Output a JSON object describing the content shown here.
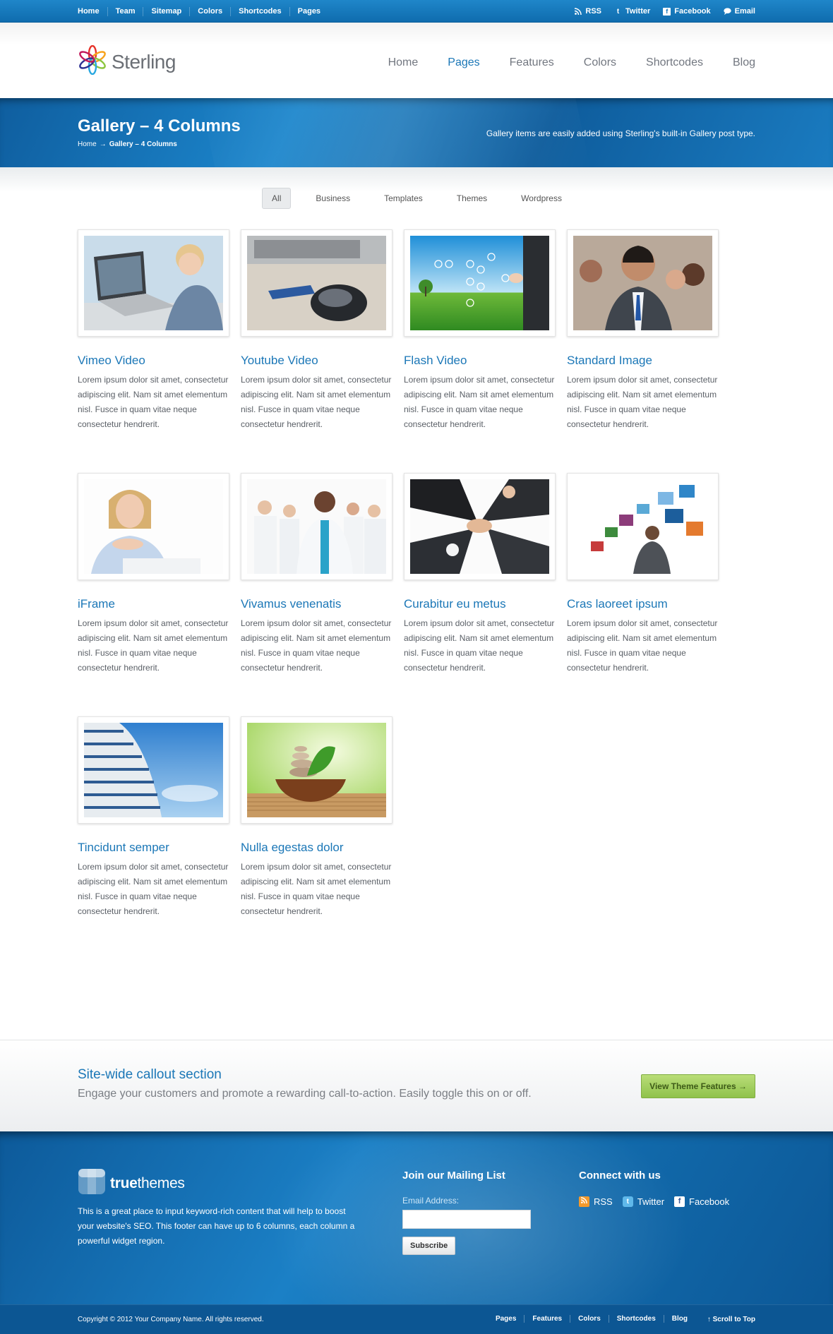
{
  "top_bar": {
    "nav": [
      "Home",
      "Team",
      "Sitemap",
      "Colors",
      "Shortcodes",
      "Pages"
    ],
    "social": [
      {
        "label": "RSS",
        "icon": "rss-icon"
      },
      {
        "label": "Twitter",
        "icon": "twitter-icon"
      },
      {
        "label": "Facebook",
        "icon": "facebook-icon"
      },
      {
        "label": "Email",
        "icon": "email-icon"
      }
    ]
  },
  "header": {
    "logo_text": "Sterling",
    "nav": [
      "Home",
      "Pages",
      "Features",
      "Colors",
      "Shortcodes",
      "Blog"
    ],
    "active": "Pages"
  },
  "banner": {
    "title": "Gallery – 4 Columns",
    "breadcrumb_home": "Home",
    "breadcrumb_arrow": "→",
    "breadcrumb_current": "Gallery – 4 Columns",
    "tagline": "Gallery items are easily added using Sterling's built-in Gallery post type."
  },
  "filters": [
    "All",
    "Business",
    "Templates",
    "Themes",
    "Wordpress"
  ],
  "active_filter": "All",
  "gallery": [
    {
      "title": "Vimeo Video",
      "text": "Lorem ipsum dolor sit amet, consectetur adipiscing elit. Nam sit amet elementum nisl. Fusce in quam vitae neque consectetur hendrerit."
    },
    {
      "title": "Youtube Video",
      "text": "Lorem ipsum dolor sit amet, consectetur adipiscing elit. Nam sit amet elementum nisl. Fusce in quam vitae neque consectetur hendrerit."
    },
    {
      "title": "Flash Video",
      "text": "Lorem ipsum dolor sit amet, consectetur adipiscing elit. Nam sit amet elementum nisl. Fusce in quam vitae neque consectetur hendrerit."
    },
    {
      "title": "Standard Image",
      "text": "Lorem ipsum dolor sit amet, consectetur adipiscing elit. Nam sit amet elementum nisl. Fusce in quam vitae neque consectetur hendrerit."
    },
    {
      "title": "iFrame",
      "text": "Lorem ipsum dolor sit amet, consectetur adipiscing elit. Nam sit amet elementum nisl. Fusce in quam vitae neque consectetur hendrerit."
    },
    {
      "title": "Vivamus venenatis",
      "text": "Lorem ipsum dolor sit amet, consectetur adipiscing elit. Nam sit amet elementum nisl. Fusce in quam vitae neque consectetur hendrerit."
    },
    {
      "title": "Curabitur eu metus",
      "text": "Lorem ipsum dolor sit amet, consectetur adipiscing elit. Nam sit amet elementum nisl. Fusce in quam vitae neque consectetur hendrerit."
    },
    {
      "title": "Cras laoreet ipsum",
      "text": "Lorem ipsum dolor sit amet, consectetur adipiscing elit. Nam sit amet elementum nisl. Fusce in quam vitae neque consectetur hendrerit."
    },
    {
      "title": "Tincidunt semper",
      "text": "Lorem ipsum dolor sit amet, consectetur adipiscing elit. Nam sit amet elementum nisl. Fusce in quam vitae neque consectetur hendrerit."
    },
    {
      "title": "Nulla egestas dolor",
      "text": "Lorem ipsum dolor sit amet, consectetur adipiscing elit. Nam sit amet elementum nisl. Fusce in quam vitae neque consectetur hendrerit."
    }
  ],
  "callout": {
    "title": "Site-wide callout section",
    "text": "Engage your customers and promote a rewarding call-to-action. Easily toggle this on or off.",
    "button": "View Theme Features →"
  },
  "footer": {
    "logo_bold": "true",
    "logo_light": "themes",
    "about": "This is a great place to input keyword-rich content that will help to boost your website's SEO. This footer can have up to 6 columns, each column a powerful widget region.",
    "mailing_title": "Join our Mailing List",
    "email_label": "Email Address:",
    "subscribe": "Subscribe",
    "connect_title": "Connect with us",
    "connect": [
      "RSS",
      "Twitter",
      "Facebook"
    ]
  },
  "sub_footer": {
    "copyright": "Copyright © 2012 Your Company Name. All rights reserved.",
    "nav": [
      "Pages",
      "Features",
      "Colors",
      "Shortcodes",
      "Blog"
    ],
    "scroll": "Scroll to Top"
  },
  "colors": {
    "accent": "#1b77b7",
    "top_bar": "#1478be",
    "cta": "#a5d060"
  }
}
